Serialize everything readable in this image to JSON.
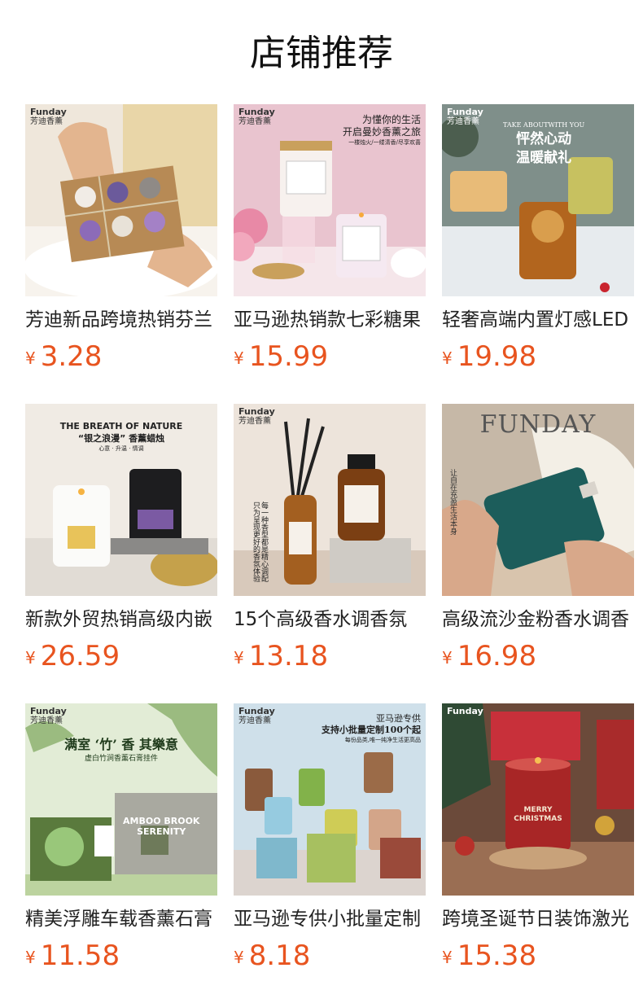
{
  "page": {
    "title": "店铺推荐"
  },
  "currency_symbol": "¥",
  "colors": {
    "price": "#e8541f",
    "title": "#222222"
  },
  "products": [
    {
      "title": "芳迪新品跨境热销芬兰",
      "price": "3.28",
      "image": {
        "brand": "Funday",
        "brand_cn": "芳迪香薰",
        "lines": []
      }
    },
    {
      "title": "亚马逊热销款七彩糖果",
      "price": "15.99",
      "image": {
        "brand": "Funday",
        "brand_cn": "芳迪香薰",
        "lines": [
          "为懂你的生活",
          "开启曼妙香薰之旅",
          "一楼烛火/一缕清香/尽享欢喜"
        ],
        "jar_text": "MAKE A WISH"
      }
    },
    {
      "title": "轻奢高端内置灯感LED",
      "price": "19.98",
      "image": {
        "brand": "Funday",
        "brand_cn": "芳迪香薰",
        "lines": [
          "TAKE ABOUTWITH YOU",
          "怦然心动",
          "温暖献礼"
        ]
      }
    },
    {
      "title": "新款外贸热销高级内嵌",
      "price": "26.59",
      "image": {
        "brand": "",
        "brand_cn": "",
        "lines": [
          "THE BREATH OF NATURE",
          "“银之浪漫” 香薰蜡烛",
          "心意 · 升温 · 情调"
        ]
      }
    },
    {
      "title": "15个高级香水调香氛",
      "price": "13.18",
      "image": {
        "brand": "Funday",
        "brand_cn": "芳迪香薰",
        "lines": [
          "每一种香型都是精心调配",
          "只为呈现更好的香氛体验"
        ]
      }
    },
    {
      "title": "高级流沙金粉香水调香",
      "price": "16.98",
      "image": {
        "brand": "",
        "brand_cn": "",
        "lines": [
          "FUNDAY",
          "让自在充盈生活本身"
        ]
      }
    },
    {
      "title": "精美浮雕车载香薰石膏",
      "price": "11.58",
      "image": {
        "brand": "Funday",
        "brand_cn": "芳迪香薰",
        "lines": [
          "满室 ‘竹’ 香 其樂意",
          "虚白竹涧香薰石膏挂件",
          "AMBOO BROOK",
          "SERENITY"
        ]
      }
    },
    {
      "title": "亚马逊专供小批量定制",
      "price": "8.18",
      "image": {
        "brand": "Funday",
        "brand_cn": "芳迪香薰",
        "lines": [
          "亚马逊专供",
          "支持小批量定制100个起",
          "每份品类,唯一纯净生活更高品"
        ]
      }
    },
    {
      "title": "跨境圣诞节日装饰激光",
      "price": "15.38",
      "image": {
        "brand": "Funday",
        "brand_cn": "",
        "lines": [
          "MERRY CHRISTMAS"
        ]
      }
    }
  ]
}
